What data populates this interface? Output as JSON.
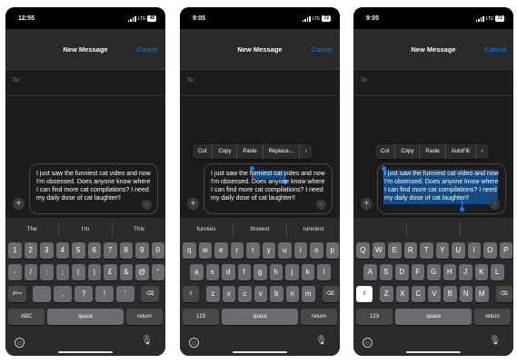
{
  "phones": [
    {
      "time": "12:55",
      "carrier": "LTE",
      "battery": "48",
      "title": "New Message",
      "cancel": "Cancel",
      "to_label": "To:",
      "message": "I just saw the funniest cat video and now I'm obsessed. Does anyone know where I can find more cat compilations? I need my daily dose of cat laughter!!",
      "suggestions": [
        "The",
        "I'm",
        "This"
      ],
      "keys": {
        "row1": [
          "1",
          "2",
          "3",
          "4",
          "5",
          "6",
          "7",
          "8",
          "9",
          "0"
        ],
        "row2": [
          "-",
          "/",
          ":",
          ";",
          "(",
          ")",
          "£",
          "&",
          "@",
          "\""
        ],
        "row3_left": "#+=",
        "row3": [
          ".",
          ",",
          "?",
          "!",
          "'"
        ],
        "mode": "ABC",
        "space": "space",
        "return": "return"
      }
    },
    {
      "time": "9:05",
      "carrier": "LTE",
      "battery": "72",
      "title": "New Message",
      "cancel": "Cancel",
      "to_label": "To:",
      "message": "I just saw the funniest cat video and now I'm obsessed. Does anyone know where I can find more cat compilations? I need my daily dose of cat laughter!!",
      "menu": [
        "Cut",
        "Copy",
        "Paste",
        "Replace...",
        "›"
      ],
      "suggestions": [
        "funnies",
        "finniest",
        "runniest"
      ],
      "keys": {
        "row1": [
          "q",
          "w",
          "e",
          "r",
          "t",
          "y",
          "u",
          "i",
          "o",
          "p"
        ],
        "row2": [
          "a",
          "s",
          "d",
          "f",
          "g",
          "h",
          "j",
          "k",
          "l"
        ],
        "row3": [
          "z",
          "x",
          "c",
          "v",
          "b",
          "n",
          "m"
        ],
        "mode": "123",
        "space": "space",
        "return": "return"
      }
    },
    {
      "time": "9:05",
      "carrier": "LTE",
      "battery": "72",
      "title": "New Message",
      "cancel": "Cancel",
      "to_label": "To:",
      "message": "I just saw the funniest cat video and now I'm obsessed. Does anyone know where I can find more cat compilations? I need my daily dose of cat laughter!!",
      "menu": [
        "Cut",
        "Copy",
        "Paste",
        "AutoFill",
        "›"
      ],
      "suggestions": [
        "",
        "",
        ""
      ],
      "keys": {
        "row1": [
          "Q",
          "W",
          "E",
          "R",
          "T",
          "Y",
          "U",
          "I",
          "O",
          "P"
        ],
        "row2": [
          "A",
          "S",
          "D",
          "F",
          "G",
          "H",
          "J",
          "K",
          "L"
        ],
        "row3": [
          "Z",
          "X",
          "C",
          "V",
          "B",
          "N",
          "M"
        ],
        "mode": "123",
        "space": "space",
        "return": "return"
      }
    }
  ],
  "icons": {
    "plus": "+",
    "send": "↑",
    "backspace": "⌫",
    "shift": "⇧",
    "emoji": "☺",
    "mic": "🎙"
  },
  "colors": {
    "accent": "#0a84ff",
    "selection": "#0a84ff"
  }
}
